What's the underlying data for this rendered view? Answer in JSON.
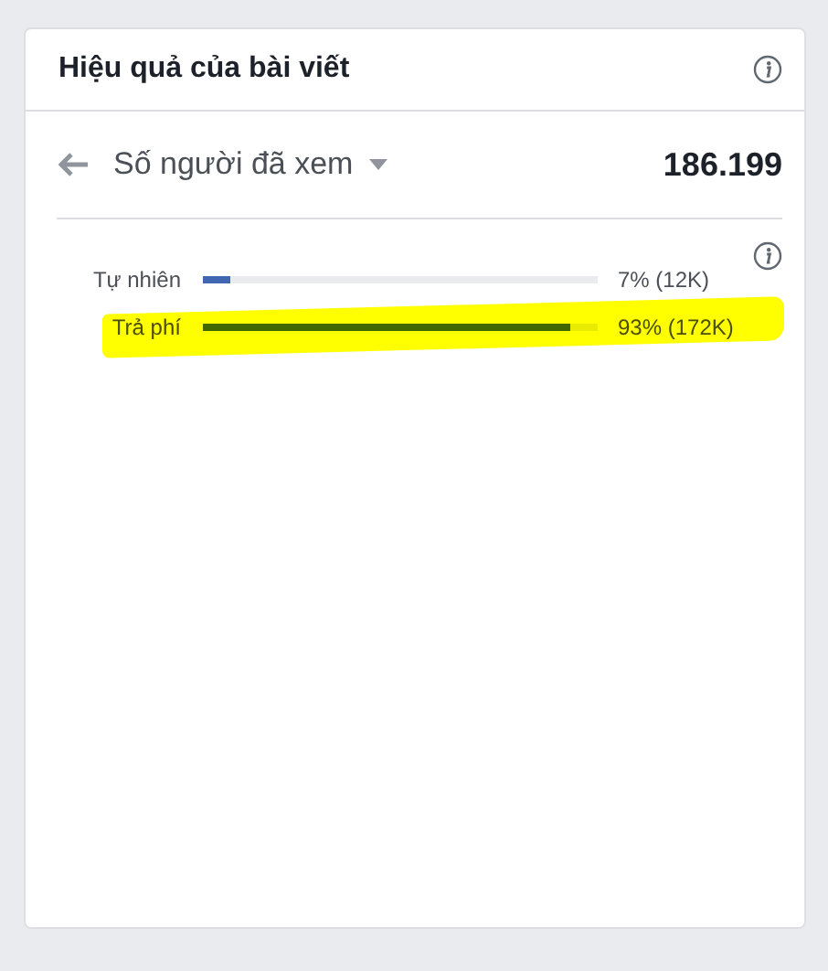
{
  "card": {
    "title": "Hiệu quả của bài viết"
  },
  "metric": {
    "label": "Số người đã xem",
    "value": "186.199"
  },
  "rows": [
    {
      "label": "Tự nhiên",
      "level": 0.07,
      "reading": "7% (12K)",
      "highlighted": false
    },
    {
      "label": "Trả phí",
      "level": 0.93,
      "reading": "93% (172K)",
      "highlighted": true
    }
  ]
}
